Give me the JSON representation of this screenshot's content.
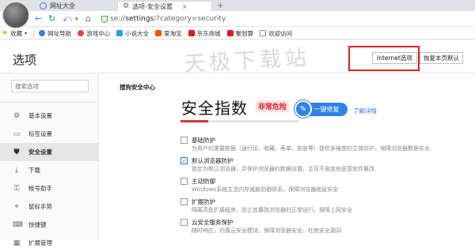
{
  "tabs": [
    {
      "label": "网址大全",
      "icon": "globe-icon"
    },
    {
      "label": "选项-安全设置",
      "icon": "gear-icon",
      "close": "×"
    }
  ],
  "nav": {
    "url_prefix": "se://",
    "url_bold": "settings",
    "url_rest": "/?category=security"
  },
  "bookmarks": [
    {
      "label": "收藏",
      "color": "#f0a000",
      "icon": "star-icon"
    },
    {
      "label": "网址导航",
      "color": "#3a7bd5",
      "icon": "globe-icon"
    },
    {
      "label": "游戏中心",
      "color": "#e04b3b",
      "icon": "game-icon"
    },
    {
      "label": "小说大全",
      "color": "#2a9fd6",
      "icon": "book-icon"
    },
    {
      "label": "爱淘宝",
      "color": "#ff5000",
      "icon": "taobao-icon"
    },
    {
      "label": "京东商城",
      "color": "#d71e1e",
      "icon": "jd-icon"
    },
    {
      "label": "聚划算",
      "color": "#e6162d",
      "icon": "juhuasuan-icon"
    },
    {
      "label": "欢迎访问",
      "color": "#8a8a8a",
      "icon": "page-icon"
    }
  ],
  "header": {
    "title": "选项",
    "watermark": "天极下载站",
    "internet_options": "Internet选项",
    "restore_default": "恢复本页默认"
  },
  "sidebar": {
    "search_placeholder": "搜索选项",
    "items": [
      {
        "label": "基本设置",
        "icon": "gear-icon",
        "glyph": "⚙"
      },
      {
        "label": "标签设置",
        "icon": "tab-icon",
        "glyph": "▭"
      },
      {
        "label": "安全设置",
        "icon": "shield-icon",
        "glyph": "⛊",
        "active": true
      },
      {
        "label": "下载",
        "icon": "download-icon",
        "glyph": "⤓"
      },
      {
        "label": "帐号助手",
        "icon": "account-icon",
        "glyph": "⚿"
      },
      {
        "label": "鼠标手势",
        "icon": "mouse-icon",
        "glyph": "⌖"
      },
      {
        "label": "快捷键",
        "icon": "keyboard-icon",
        "glyph": "⌨"
      },
      {
        "label": "扩展管理",
        "icon": "extension-icon",
        "glyph": "▦"
      }
    ]
  },
  "security": {
    "section_label": "搜狗安全中心",
    "index_title": "安全指数",
    "danger_badge": "非常危险",
    "fix_button": "一键修复",
    "detail_link": "了解详情",
    "progress_fraction": 0.23,
    "options": [
      {
        "title": "基础防护",
        "desc": "为用户的重要数据（通行证、收藏、表单、皮肤等）提供多维度的立体防护，保障浏览器数据安全",
        "checked": false
      },
      {
        "title": "默认浏览器防护",
        "desc": "锁定为默认浏览器，并保护浏览器的数据设置，主页不被其他恶意软件篡改",
        "checked": true
      },
      {
        "title": "主动防御",
        "desc": "Windows系统主流内存威胁防御体系，保障浏览器底层安全",
        "checked": false
      },
      {
        "title": "扩展防护",
        "desc": "隔离高危扩展程序，防止其篡改浏览器的正常运行，保障上网安全",
        "checked": false
      },
      {
        "title": "云安全服务保护",
        "desc": "随时响应，内置云安全模块，保障浏览器安全，杜绝安全漏洞",
        "checked": false
      }
    ]
  }
}
